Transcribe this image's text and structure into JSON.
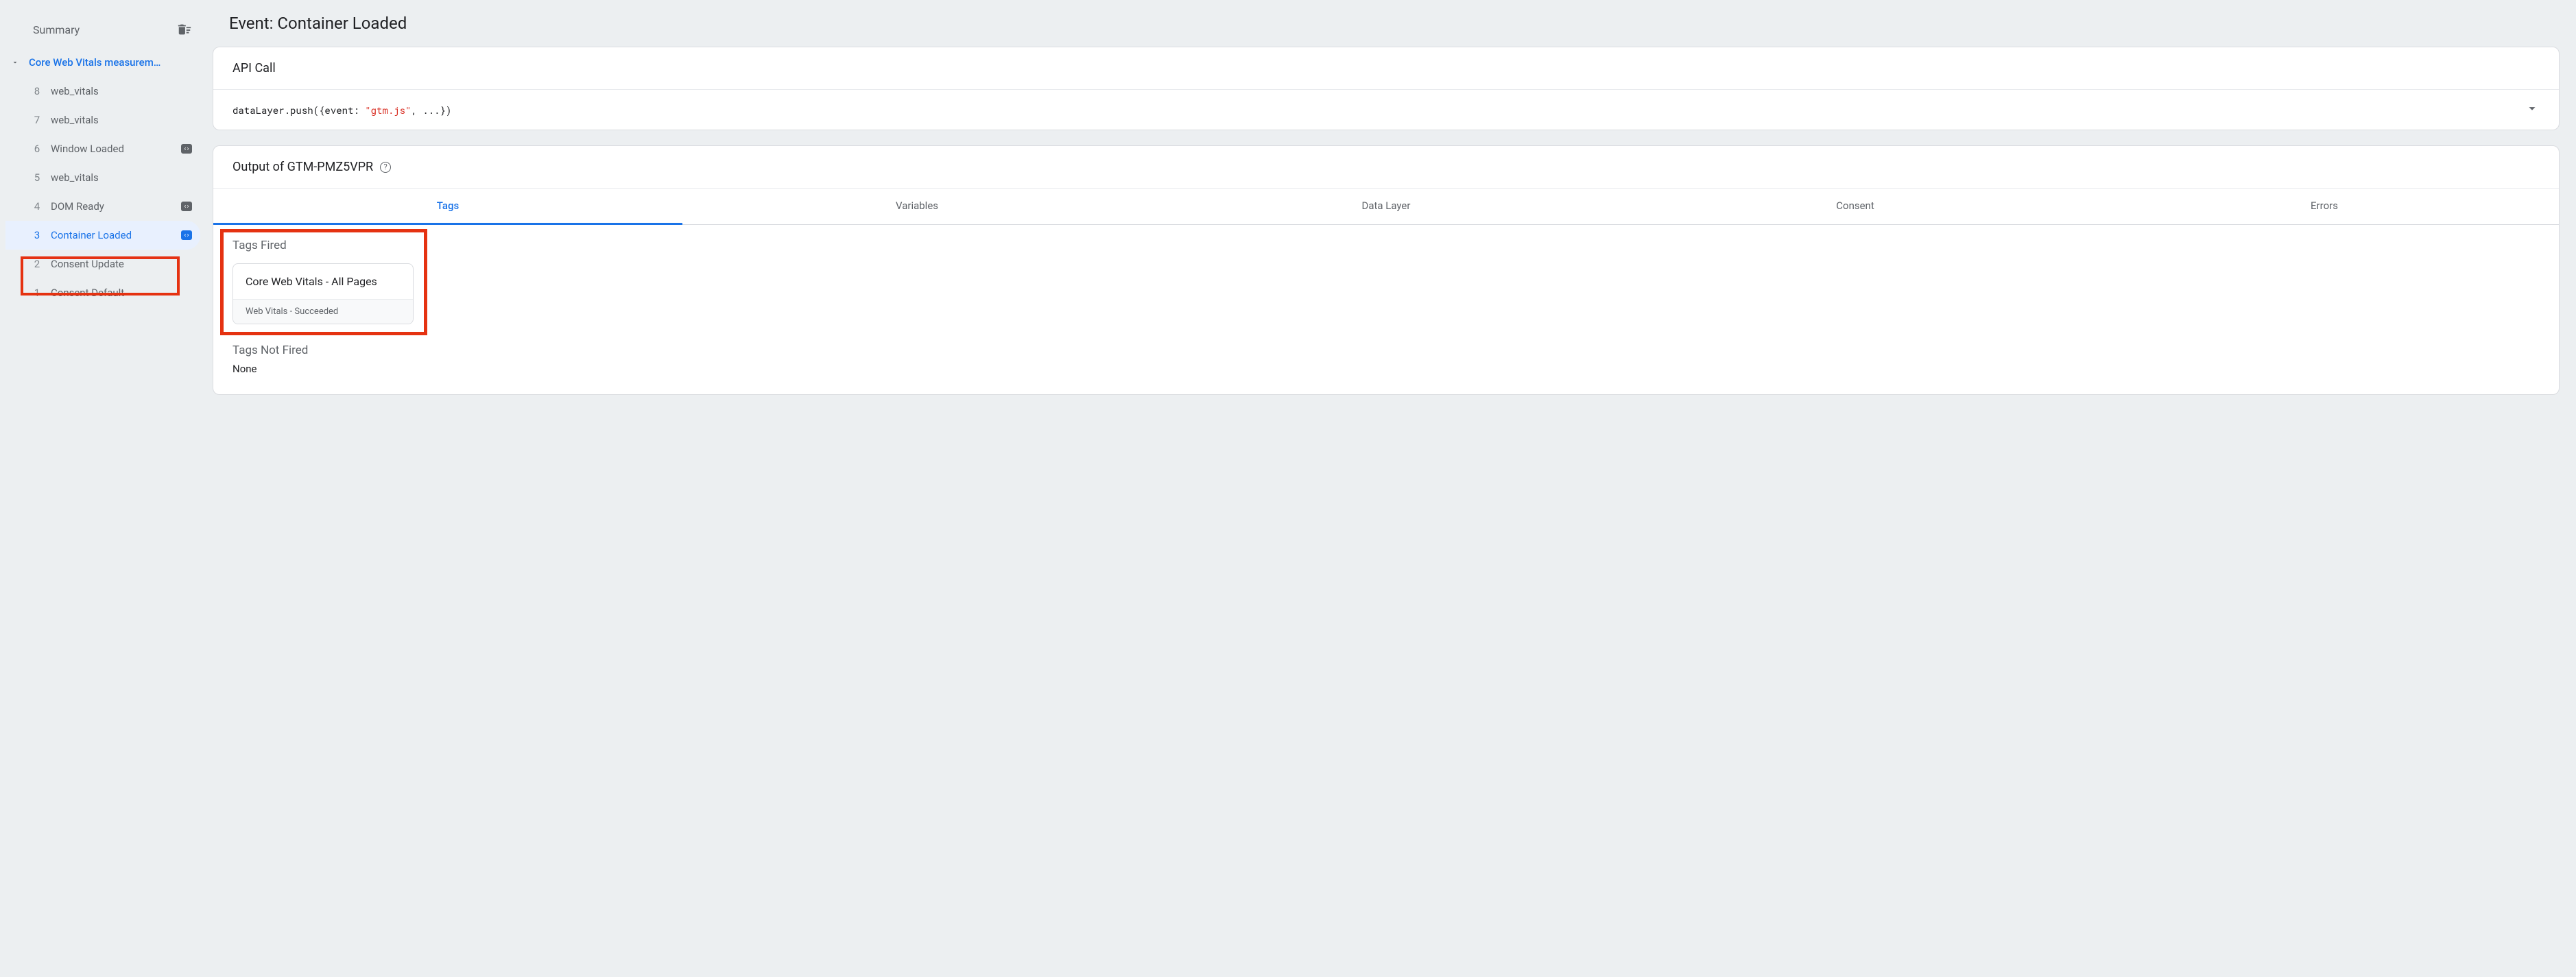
{
  "sidebar": {
    "summary_label": "Summary",
    "root_label": "Core Web Vitals measurem…",
    "items": [
      {
        "num": "8",
        "label": "web_vitals",
        "badge": false
      },
      {
        "num": "7",
        "label": "web_vitals",
        "badge": false
      },
      {
        "num": "6",
        "label": "Window Loaded",
        "badge": true
      },
      {
        "num": "5",
        "label": "web_vitals",
        "badge": false
      },
      {
        "num": "4",
        "label": "DOM Ready",
        "badge": true
      },
      {
        "num": "3",
        "label": "Container Loaded",
        "badge": true,
        "selected": true
      },
      {
        "num": "2",
        "label": "Consent Update",
        "badge": false
      },
      {
        "num": "1",
        "label": "Consent Default",
        "badge": false
      }
    ]
  },
  "main": {
    "title": "Event: Container Loaded",
    "api_call": {
      "header": "API Call",
      "code_pre": "dataLayer.push({event: ",
      "code_str": "\"gtm.js\"",
      "code_post": ", ...})"
    },
    "output": {
      "header": "Output of GTM-PMZ5VPR",
      "tabs": [
        "Tags",
        "Variables",
        "Data Layer",
        "Consent",
        "Errors"
      ],
      "tags_fired_label": "Tags Fired",
      "tag_card_title": "Core Web Vitals - All Pages",
      "tag_card_status": "Web Vitals - Succeeded",
      "tags_not_fired_label": "Tags Not Fired",
      "not_fired_value": "None"
    }
  }
}
